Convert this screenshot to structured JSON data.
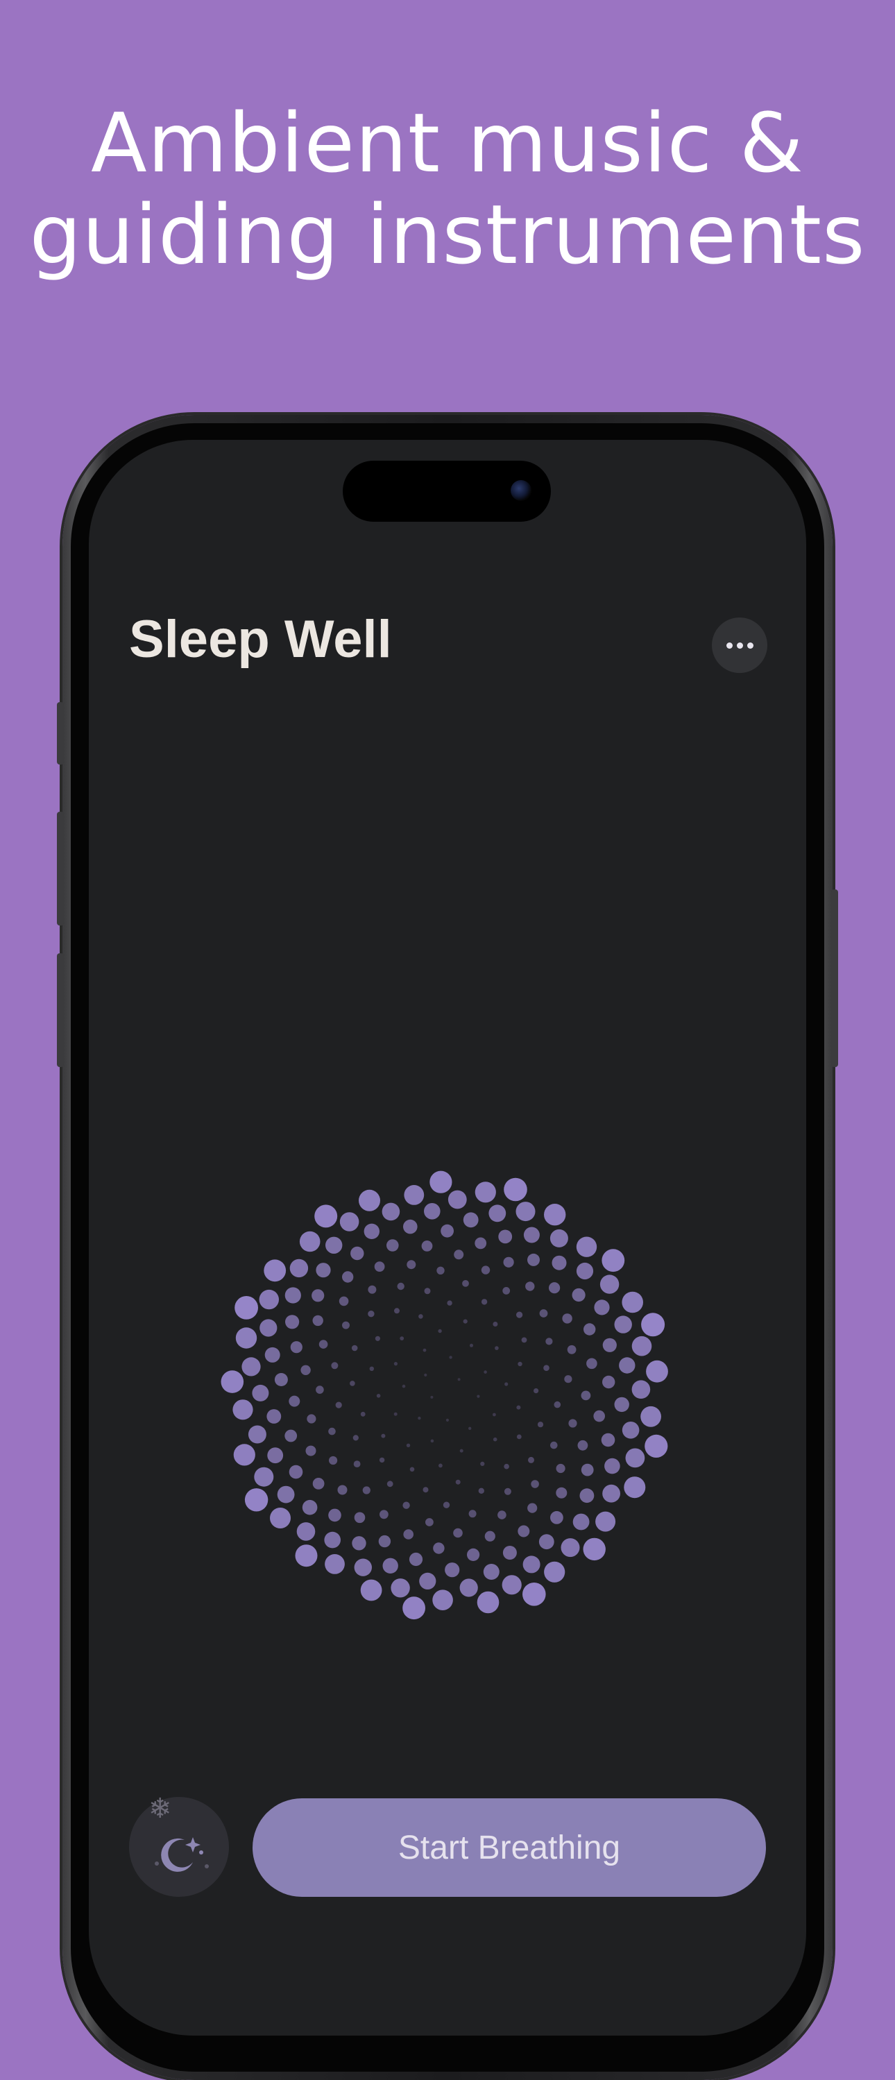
{
  "headline": {
    "line1": "Ambient music &",
    "line2": "guiding instruments"
  },
  "app": {
    "title": "Sleep Well",
    "more_icon": "ellipsis-icon",
    "start_button_label": "Start Breathing",
    "sound_icon": "moon-stars-icon"
  },
  "colors": {
    "background": "#9b74c2",
    "screen": "#1f2022",
    "accent": "#8a81b5",
    "dot": "#9585c8"
  }
}
